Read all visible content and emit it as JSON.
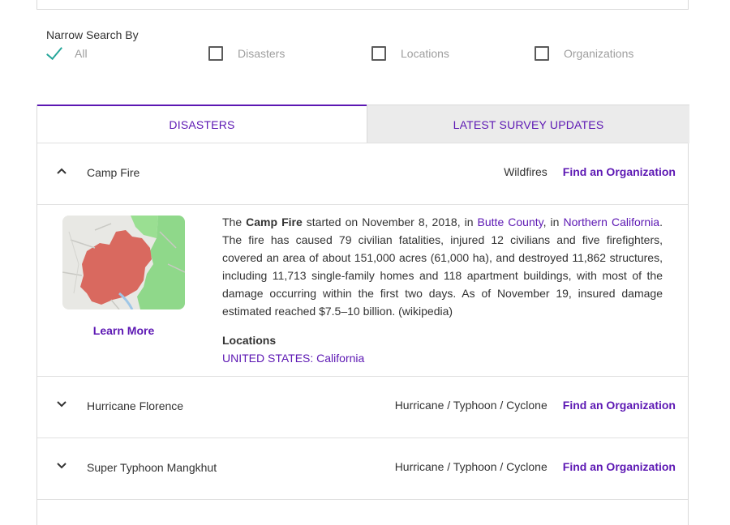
{
  "narrow_search": {
    "title": "Narrow Search By",
    "options": [
      {
        "label": "All",
        "checked": true
      },
      {
        "label": "Disasters",
        "checked": false
      },
      {
        "label": "Locations",
        "checked": false
      },
      {
        "label": "Organizations",
        "checked": false
      }
    ]
  },
  "tabs": [
    {
      "label": "DISASTERS",
      "active": true
    },
    {
      "label": "LATEST SURVEY UPDATES",
      "active": false
    }
  ],
  "disasters": [
    {
      "name": "Camp Fire",
      "type": "Wildfires",
      "action": "Find an Organization",
      "expanded": true,
      "learn_more": "Learn More",
      "description": {
        "p1": "The ",
        "bold": "Camp Fire",
        "p2": " started on November 8, 2018, in ",
        "link1": "Butte County",
        "p3": ", in ",
        "link2": "Northern California",
        "p4": ". The fire has caused 79 civilian fatalities, injured 12 civilians and five firefighters, covered an area of about 151,000 acres (61,000 ha), and destroyed 11,862 structures, including 11,713 single-family homes and 118 apartment buildings, with most of the damage occurring within the first two days. As of November 19, insured damage estimated reached $7.5–10 billion. (wikipedia)"
      },
      "locations_heading": "Locations",
      "location": "UNITED STATES: California"
    },
    {
      "name": "Hurricane Florence",
      "type": "Hurricane / Typhoon / Cyclone",
      "action": "Find an Organization",
      "expanded": false
    },
    {
      "name": "Super Typhoon Mangkhut",
      "type": "Hurricane / Typhoon / Cyclone",
      "action": "Find an Organization",
      "expanded": false
    }
  ],
  "colors": {
    "accent": "#5c17b3",
    "check": "#26a69a",
    "fire_area": "#d9695f",
    "green_area": "#8fd88a"
  }
}
